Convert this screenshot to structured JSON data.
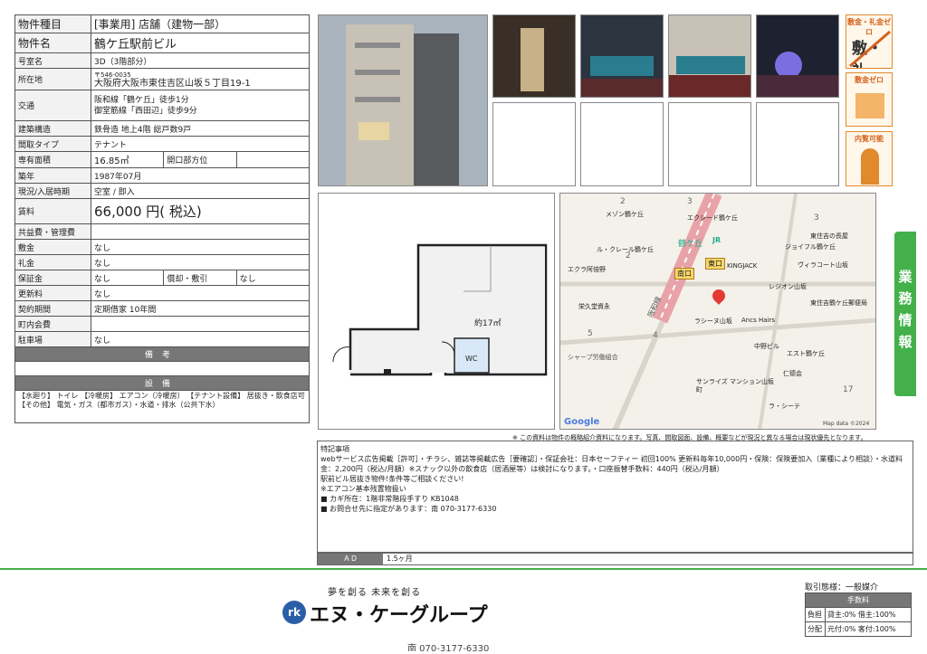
{
  "spec": {
    "type_label": "物件種目",
    "type_value": "[事業用] 店舗（建物一部）",
    "name_label": "物件名",
    "name_value": "鶴ケ丘駅前ビル",
    "room_label": "号室名",
    "room_value": "3D（3階部分）",
    "addr_label": "所在地",
    "addr_zip": "〒546-0035",
    "addr_value": "大阪府大阪市東住吉区山坂５丁目19-1",
    "traffic_label": "交通",
    "traffic_1": "阪和線「鶴ケ丘」徒歩1分",
    "traffic_2": "御堂筋線「西田辺」徒歩9分",
    "struct_label": "建築構造",
    "struct_value": "鉄骨造 地上4階 総戸数9戸",
    "layout_label": "間取タイプ",
    "layout_value": "テナント",
    "area_label": "専有面積",
    "area_value": "16.85㎡",
    "opening_label": "開口部方位",
    "opening_value": "",
    "built_label": "築年",
    "built_value": "1987年07月",
    "status_label": "現況/入居時期",
    "status_value": "空室 / 即入",
    "rent_label": "賃料",
    "rent_value": "66,000 円( 税込)",
    "common_label": "共益費・管理費",
    "common_value": "",
    "deposit_label": "敷金",
    "deposit_value": "なし",
    "key_label": "礼金",
    "key_value": "なし",
    "guarantee_label": "保証金",
    "guarantee_value": "なし",
    "amort_label": "償却・敷引",
    "amort_value": "なし",
    "renew_label": "更新料",
    "renew_value": "なし",
    "contract_label": "契約期間",
    "contract_value": "定期借家 10年間",
    "town_label": "町内会費",
    "town_value": "",
    "parking_label": "駐車場",
    "parking_value": "なし",
    "remarks_header": "備考",
    "facility_header": "設備",
    "facility_text": "【水廻り】 トイレ 【冷暖房】 エアコン（冷暖房） 【テナント設備】 居抜き・飲食店可 【その他】 電気・ガス（都市ガス）・水道・排水（公共下水）"
  },
  "badges": {
    "top": "敷金・礼金ゼロ",
    "mid": "敷金ゼロ",
    "bottom": "内覧可能"
  },
  "side_tab": "業務情報",
  "floorplan": {
    "area": "約17㎡",
    "wc": "WC"
  },
  "map": {
    "station": "鶴ケ丘",
    "jr": "JR",
    "exit_s": "南口",
    "exit_e": "東口",
    "rail": "阪和線",
    "places": [
      "メゾン鶴ケ丘",
      "エクシード鶴ケ丘",
      "東住吉の長屋",
      "ジョイフル鶴ケ丘",
      "ル・クレール鶴ケ丘",
      "ヴィラコート山坂",
      "エクラ阿倍野",
      "KINGJACK",
      "レジオン山坂",
      "栄久堂資永",
      "東住吉鶴ケ丘郵便局",
      "ラシーヌ山坂",
      "Ancs Hairs",
      "中野ビル",
      "エスト鶴ケ丘",
      "シャープ労働組合",
      "仁德会",
      "サンライズ マンション山坂町",
      "ラ・シーテ"
    ],
    "nums": [
      "2",
      "3",
      "2",
      "3",
      "5",
      "4",
      "17"
    ],
    "google": "Google",
    "copyright": "Map data ©2024"
  },
  "disclaimer": "※ この資料は物件の概略紹介資料になります。写真、間取図面、設備、概要などが現況と異なる場合は現状優先となります。",
  "notes": {
    "title": "特記事項",
    "lines": [
      "webサービス広告掲載［許可］・チラシ、雑誌等掲載広告［要確認］・保証会社：日本セーフティー 初回100% 更新料毎年10,000円・保険：保険要加入（業種により相談）・水道料金：2,200円（税込/月額）※スナック以外の飲食店（居酒屋等）は検討になります。・口座振替手数料：440円（税込/月額）",
      "駅前ビル居抜き物件!条件等ご相談ください!",
      "※エアコン基本残置物扱い",
      "■ カギ所在：1階非常階段手すり KB1048",
      "■ お問合せ先に指定があります：南 070-3177-6330"
    ],
    "ad_label": "ＡＤ",
    "ad_value": "1.5ヶ月"
  },
  "footer": {
    "slogan": "夢を創る 未来を創る",
    "logo_mark": "rk",
    "company": "エヌ・ケーグループ",
    "deal_title": "取引態様：一般媒介",
    "fee_header": "手数料",
    "burden_label": "負担",
    "burden_value": "貸主:0% 借主:100%",
    "split_label": "分配",
    "split_value": "元付:0% 客付:100%",
    "phone_partial": "南 070-3177-6330"
  },
  "colors": {
    "green": "#43b04a",
    "orange": "#e08a2c",
    "header_gray": "#777777"
  }
}
